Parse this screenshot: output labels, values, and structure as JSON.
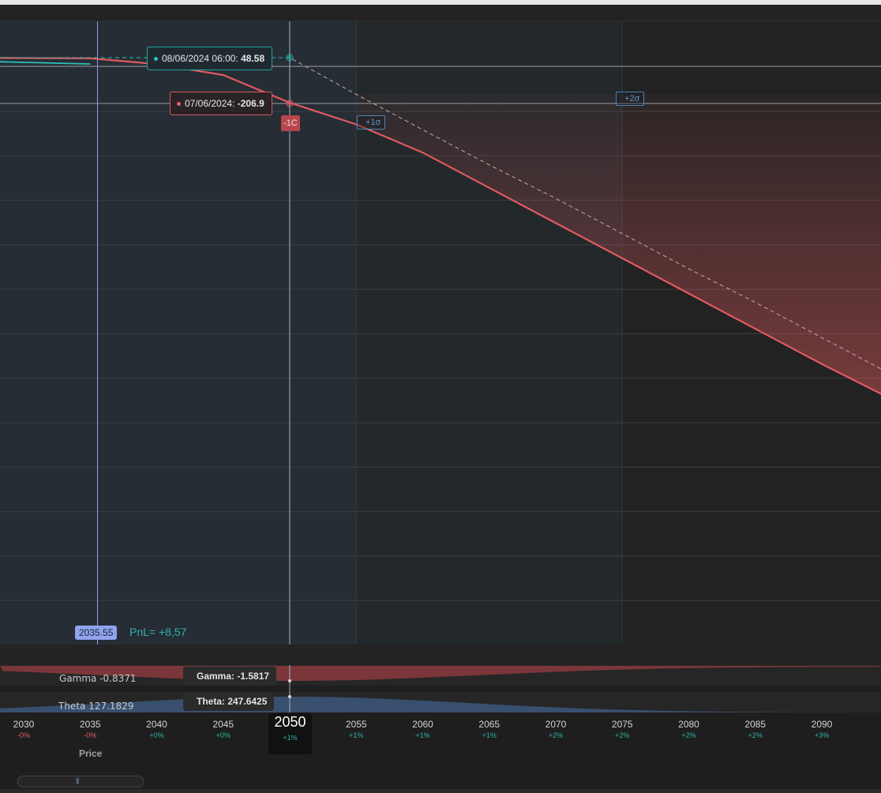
{
  "colors": {
    "teal": "#2bbfb4",
    "red": "#e05a5e",
    "blue": "#8fa3ee",
    "pos": "#2fb3a8",
    "neg": "#e06064"
  },
  "tooltips": {
    "teal_label": "08/06/2024 06:00:",
    "teal_value": "48.58",
    "red_label": "07/06/2024:",
    "red_value": "-206.9",
    "badge_1c": "-1C",
    "sigma1": "+1σ",
    "sigma2": "+2σ"
  },
  "price": {
    "badge": "2035.55",
    "pnl": "PnL= +8,57"
  },
  "greeks": {
    "gamma_left": "Gamma -0.8371",
    "theta_left": "Theta 127.1829",
    "gamma_tip": "Gamma: -1.5817",
    "theta_tip": "Theta: 247.6425"
  },
  "xaxis": {
    "title": "Price",
    "selected": {
      "value": "2050",
      "pct": "+1%"
    },
    "ticks": [
      {
        "value": "2030",
        "pct": "-0%",
        "sign": "neg"
      },
      {
        "value": "2035",
        "pct": "-0%",
        "sign": "neg"
      },
      {
        "value": "2040",
        "pct": "+0%",
        "sign": "pos"
      },
      {
        "value": "2045",
        "pct": "+0%",
        "sign": "pos"
      },
      {
        "value": "2055",
        "pct": "+1%",
        "sign": "pos"
      },
      {
        "value": "2060",
        "pct": "+1%",
        "sign": "pos"
      },
      {
        "value": "2065",
        "pct": "+1%",
        "sign": "pos"
      },
      {
        "value": "2070",
        "pct": "+2%",
        "sign": "pos"
      },
      {
        "value": "2075",
        "pct": "+2%",
        "sign": "pos"
      },
      {
        "value": "2080",
        "pct": "+2%",
        "sign": "pos"
      },
      {
        "value": "2085",
        "pct": "+2%",
        "sign": "pos"
      },
      {
        "value": "2090",
        "pct": "+3%",
        "sign": "pos"
      }
    ]
  },
  "chart_data": {
    "type": "line",
    "xlabel": "Price",
    "series": [
      {
        "name": "08/06/2024 06:00",
        "color": "#2bbfb4",
        "style": "dashed",
        "x": [
          2023,
          2035,
          2050,
          2055,
          2060,
          2065,
          2070,
          2075,
          2080,
          2085,
          2090,
          2095
        ],
        "y": [
          48.58,
          48.58,
          48.58,
          -160,
          -360,
          -560,
          -750,
          -950,
          -1150,
          -1340,
          -1540,
          -1740
        ]
      },
      {
        "name": "07/06/2024",
        "color": "#e05a5e",
        "style": "solid",
        "x": [
          2023,
          2035,
          2040,
          2045,
          2050,
          2055,
          2060,
          2065,
          2070,
          2075,
          2080,
          2085,
          2090,
          2095
        ],
        "y": [
          48.6,
          45,
          12,
          -50,
          -206.9,
          -330,
          -490,
          -690,
          -890,
          -1090,
          -1290,
          -1490,
          -1690,
          -1880
        ]
      }
    ],
    "markers": {
      "current_price": 2035.55,
      "selected_price": 2050,
      "sigma1": 2055,
      "sigma2": 2075
    }
  }
}
